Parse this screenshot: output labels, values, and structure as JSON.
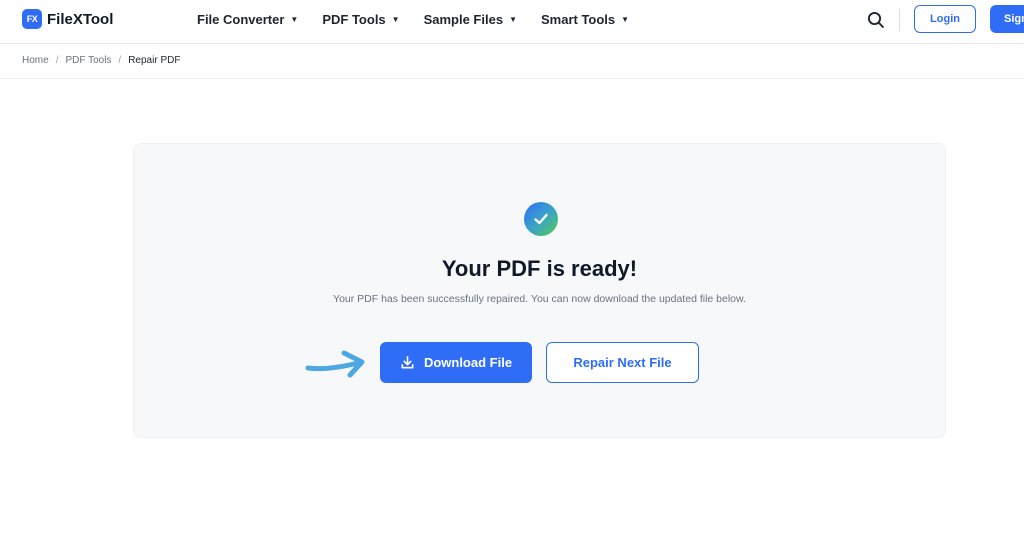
{
  "brand": {
    "badge_text": "FX",
    "name": "FileXTool",
    "color": "#2f6df6"
  },
  "nav": {
    "items": [
      {
        "label": "File Converter",
        "icon": "caret-down-icon"
      },
      {
        "label": "PDF Tools",
        "icon": "caret-down-icon"
      },
      {
        "label": "Sample Files",
        "icon": "caret-down-icon"
      },
      {
        "label": "Smart Tools",
        "icon": "caret-down-icon"
      }
    ],
    "search_icon": "search-icon",
    "login_label": "Login",
    "signup_label": "Sign"
  },
  "breadcrumb": {
    "items": [
      "Home",
      "PDF Tools"
    ],
    "separator": "/",
    "current": "Repair PDF"
  },
  "result": {
    "icon": "check-circle-icon",
    "title": "Your PDF is ready!",
    "subtitle": "Your PDF has been successfully repaired. You can now download the updated file below.",
    "download_label": "Download File",
    "download_icon": "download-icon",
    "repair_next_label": "Repair Next File",
    "annotation_arrow": "arrow-right-icon"
  },
  "colors": {
    "primary": "#2f6df6",
    "card_background": "#f7f8fa",
    "annotation_arrow": "#4ea7e0",
    "success_gradient": [
      "#2f6df6",
      "#52cc52"
    ]
  }
}
